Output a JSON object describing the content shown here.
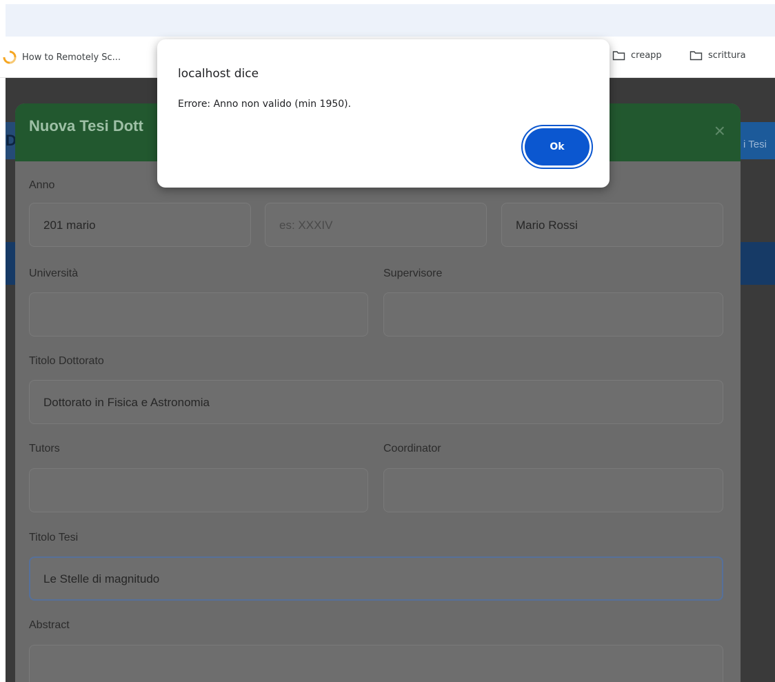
{
  "browser": {
    "bookmarks": [
      {
        "label": "How to Remotely Sc...",
        "icon": "loading-spinner-icon"
      },
      {
        "label": "creapp",
        "icon": "folder-icon"
      },
      {
        "label": "scrittura",
        "icon": "folder-icon"
      }
    ]
  },
  "background_page": {
    "header_button_text": "i Tesi",
    "left_chip_text": "D"
  },
  "modal": {
    "title": "Nuova Tesi Dott",
    "close_symbol": "×",
    "fields": {
      "anno": {
        "label": "Anno",
        "value": "201 mario"
      },
      "ciclo": {
        "placeholder": "es: XXXIV"
      },
      "autore": {
        "value": "Mario Rossi"
      },
      "universita": {
        "label": "Università",
        "value": ""
      },
      "supervisore": {
        "label": "Supervisore",
        "value": ""
      },
      "titolo_dottorato": {
        "label": "Titolo Dottorato",
        "value": "Dottorato in Fisica e Astronomia"
      },
      "tutors": {
        "label": "Tutors",
        "value": ""
      },
      "coordinator": {
        "label": "Coordinator",
        "value": ""
      },
      "titolo_tesi": {
        "label": "Titolo Tesi",
        "value": "Le Stelle di magnitudo"
      },
      "abstract": {
        "label": "Abstract",
        "value": ""
      }
    }
  },
  "alert": {
    "title": "localhost dice",
    "message": "Errore: Anno non valido (min 1950).",
    "ok_label": "Ok"
  },
  "colors": {
    "modal_header": "#22582f",
    "alert_button": "#0b57d0",
    "background_blue": "#163a66"
  }
}
